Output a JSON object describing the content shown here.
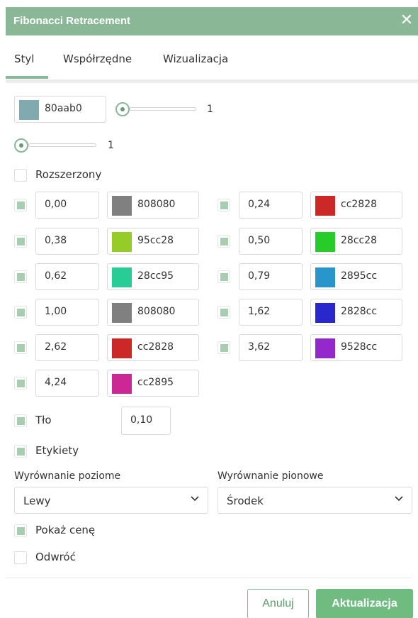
{
  "dialog": {
    "title": "Fibonacci Retracement",
    "close_glyph": "✕"
  },
  "tabs": [
    {
      "label": "Styl",
      "active": true
    },
    {
      "label": "Współrzędne",
      "active": false
    },
    {
      "label": "Wizualizacja",
      "active": false
    }
  ],
  "style": {
    "line_color": {
      "hex": "80aab0",
      "color": "#80aab0"
    },
    "line_width": {
      "value": "1",
      "level": 0
    },
    "second_slider": {
      "value": "1",
      "level": 0
    },
    "extended": {
      "label": "Rozszerzony",
      "checked": false
    }
  },
  "levels": [
    {
      "value": "0,00",
      "hex": "808080",
      "color": "#808080",
      "checked": true
    },
    {
      "value": "0,24",
      "hex": "cc2828",
      "color": "#cc2828",
      "checked": true
    },
    {
      "value": "0,38",
      "hex": "95cc28",
      "color": "#95cc28",
      "checked": true
    },
    {
      "value": "0,50",
      "hex": "28cc28",
      "color": "#28cc28",
      "checked": true
    },
    {
      "value": "0,62",
      "hex": "28cc95",
      "color": "#28cc95",
      "checked": true
    },
    {
      "value": "0,79",
      "hex": "2895cc",
      "color": "#2895cc",
      "checked": true
    },
    {
      "value": "1,00",
      "hex": "808080",
      "color": "#808080",
      "checked": true
    },
    {
      "value": "1,62",
      "hex": "2828cc",
      "color": "#2828cc",
      "checked": true
    },
    {
      "value": "2,62",
      "hex": "cc2828",
      "color": "#cc2828",
      "checked": true
    },
    {
      "value": "3,62",
      "hex": "9528cc",
      "color": "#9528cc",
      "checked": true
    },
    {
      "value": "4,24",
      "hex": "cc2895",
      "color": "#cc2895",
      "checked": true
    }
  ],
  "background": {
    "label": "Tło",
    "checked": true,
    "opacity": "0,10"
  },
  "labels": {
    "label": "Etykiety",
    "checked": true
  },
  "horizontal_align": {
    "label": "Wyrównanie poziome",
    "value": "Lewy"
  },
  "vertical_align": {
    "label": "Wyrównanie pionowe",
    "value": "Środek"
  },
  "show_price": {
    "label": "Pokaż cenę",
    "checked": true
  },
  "reverse": {
    "label": "Odwróć",
    "checked": false
  },
  "buttons": {
    "cancel": "Anuluj",
    "update": "Aktualizacja"
  },
  "colors": {
    "accent": "#8ab897",
    "button_green": "#6fbb80"
  }
}
